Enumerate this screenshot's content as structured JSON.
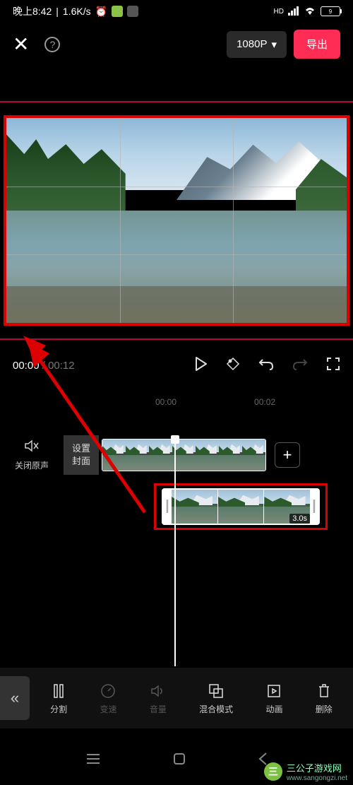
{
  "status": {
    "time": "晚上8:42",
    "speed": "1.6K/s",
    "hd": "HD",
    "battery": "9"
  },
  "header": {
    "resolution": "1080P",
    "export": "导出"
  },
  "player": {
    "current": "00:00",
    "duration": "00:12"
  },
  "ruler": {
    "t0": "00:00",
    "t1": "00:02"
  },
  "sound": {
    "label": "关闭原声"
  },
  "cover": {
    "line1": "设置",
    "line2": "封面"
  },
  "clip": {
    "duration": "3.0s"
  },
  "tools": {
    "split": "分割",
    "speed": "变速",
    "volume": "音量",
    "blend": "混合模式",
    "anim": "动画",
    "delete": "删除"
  },
  "watermark": {
    "text": "三公子游戏网",
    "url": "www.sangongzi.net"
  }
}
